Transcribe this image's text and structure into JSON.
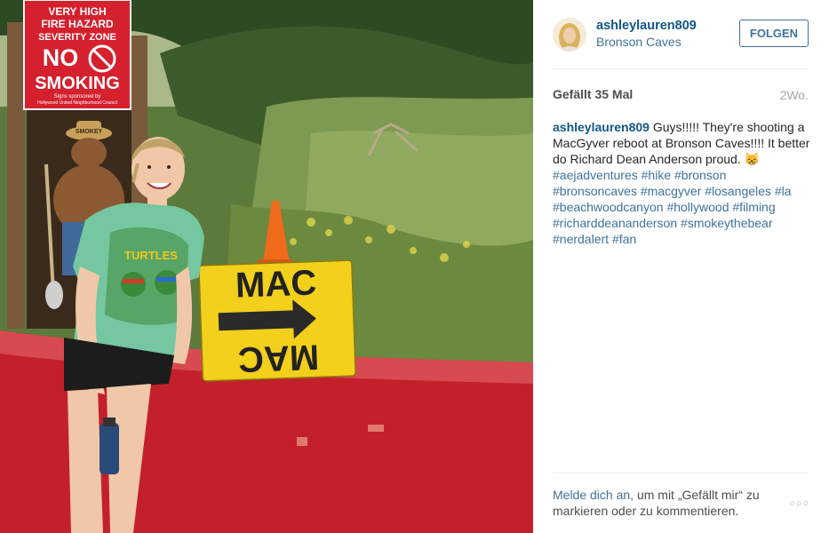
{
  "post": {
    "username": "ashleylauren809",
    "location": "Bronson Caves",
    "follow_label": "FOLGEN",
    "likes": "Gefällt 35 Mal",
    "time": "2Wo.",
    "caption": {
      "username": "ashleylauren809",
      "text": " Guys!!!!! They're shooting a MacGyver reboot at Bronson Caves!!!! It better do Richard Dean Anderson proud. 😸",
      "hashtags": [
        "#aejadventures",
        "#hike",
        "#bronson",
        "#bronsoncaves",
        "#macgyver",
        "#losangeles",
        "#la",
        "#beachwoodcanyon",
        "#hollywood",
        "#filming",
        "#richarddeananderson",
        "#smokeythebear",
        "#nerdalert",
        "#fan"
      ]
    },
    "footer": {
      "login_link": "Melde dich an",
      "login_text": ", um mit „Gefällt mir“ zu markieren oder zu kommentieren.",
      "more_icon": "ellipsis-icon",
      "more_label": "○○○"
    }
  },
  "photo": {
    "sign_text": {
      "line1": "VERY HIGH",
      "line2": "FIRE HAZARD",
      "line3": "SEVERITY ZONE",
      "line4": "NO",
      "line5": "SMOKING",
      "line6": "Signs sponsored by",
      "line7": "Hollywood United Neighborhood Council"
    },
    "smokey_hat": "SMOKEY",
    "mac_top": "MAC",
    "mac_bottom": "MAC",
    "shirt_text": "TURTLES"
  },
  "colors": {
    "link": "#3f729b",
    "username": "#125688",
    "wall_red": "#c4202b",
    "sign_yellow": "#f2d01b",
    "sign_red": "#d5202e"
  }
}
